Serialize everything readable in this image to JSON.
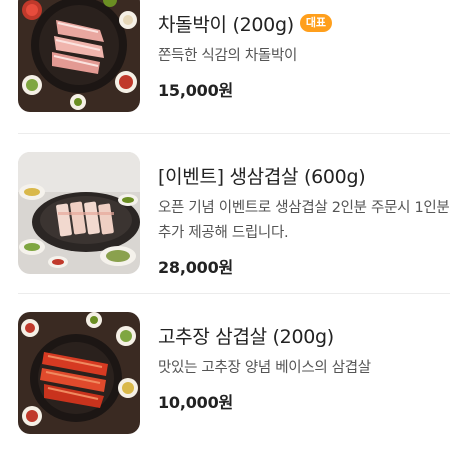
{
  "menu": {
    "items": [
      {
        "title": "차돌박이 (200g)",
        "badge": "대표",
        "description": "쫀득한 식감의 차돌박이",
        "price": "15,000원",
        "image_icon": "grilled-meat-photo"
      },
      {
        "title": "[이벤트] 생삼겹살 (600g)",
        "badge": "",
        "description": "오픈 기념 이벤트로 생삼겹살 2인분 주문시 1인분 추가 제공해 드립니다.",
        "price": "28,000원",
        "image_icon": "pork-belly-photo"
      },
      {
        "title": "고추장 삼겹살 (200g)",
        "badge": "",
        "description": "맛있는 고추장 양념 베이스의 삼겹살",
        "price": "10,000원",
        "image_icon": "spicy-pork-photo"
      }
    ]
  },
  "colors": {
    "badge": "#ff9f1c",
    "divider": "#ececec",
    "price": "#222222"
  }
}
